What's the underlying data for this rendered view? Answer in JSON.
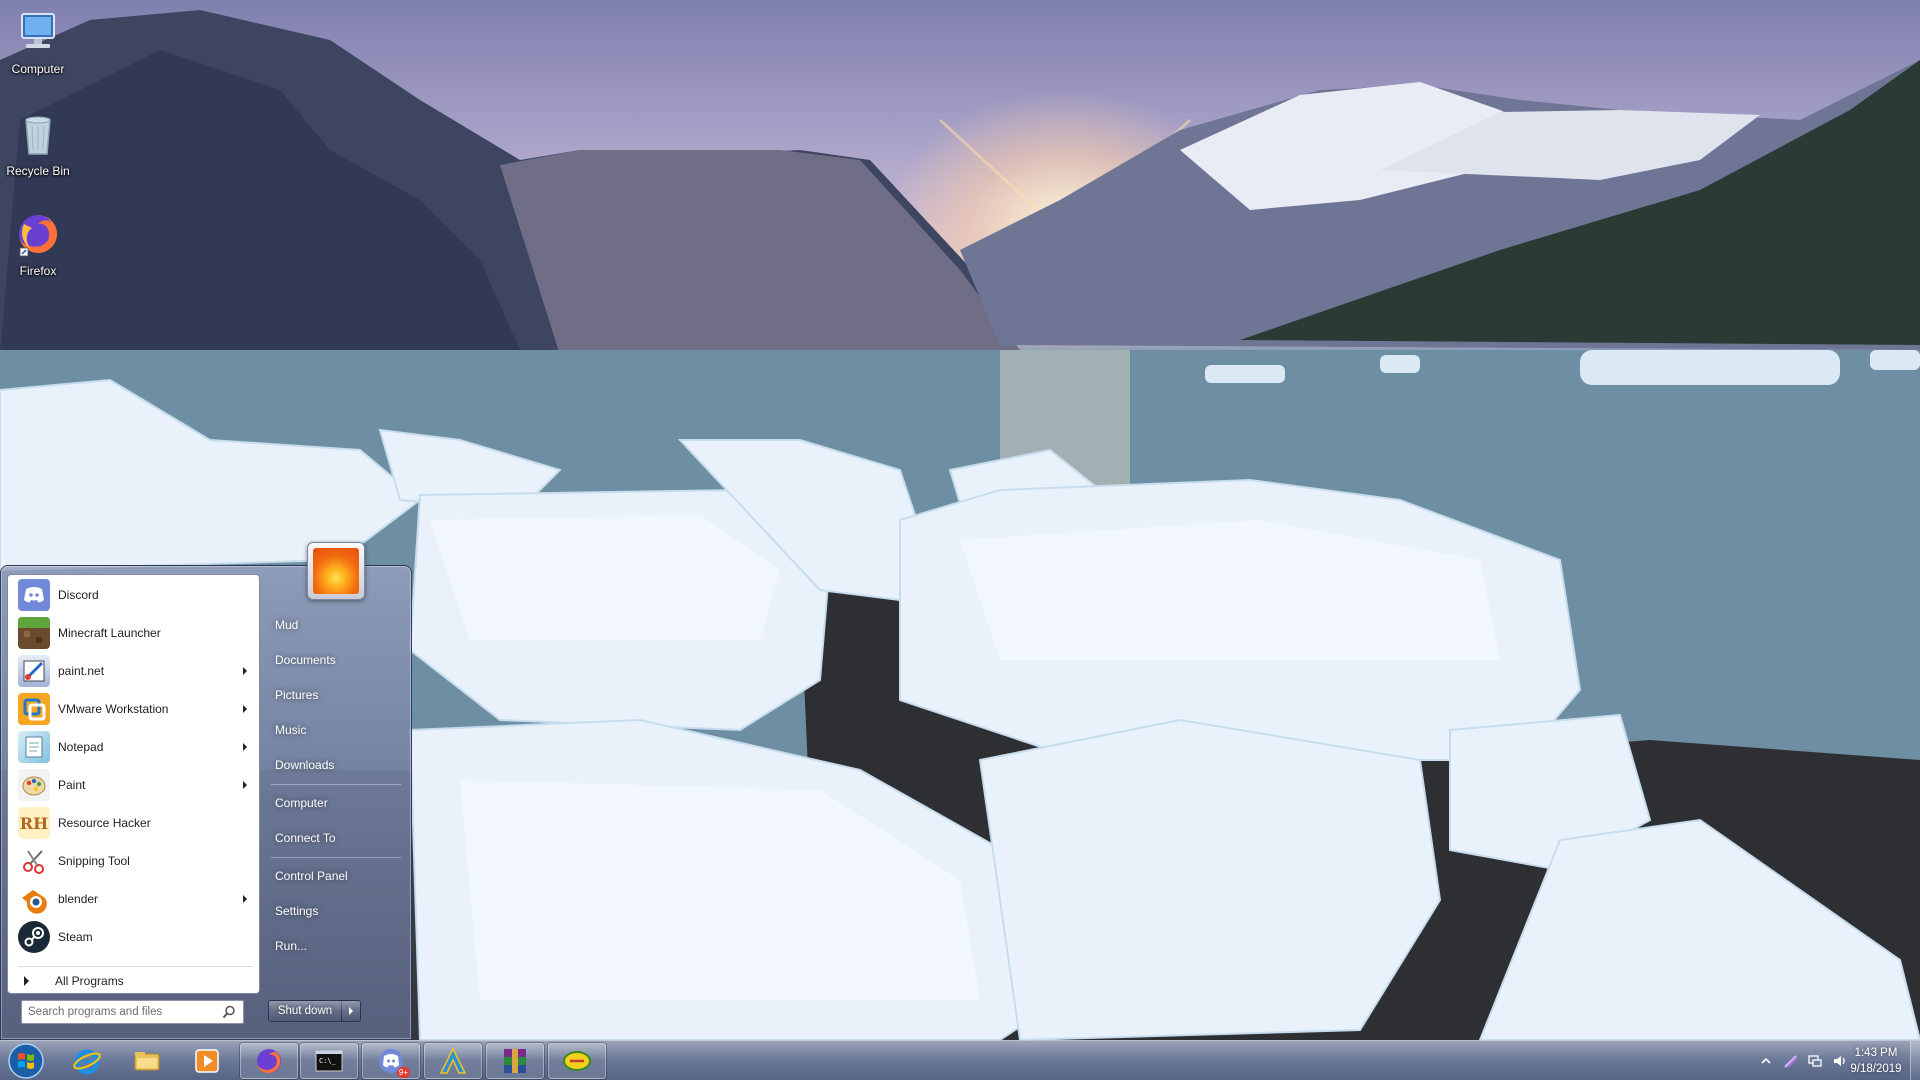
{
  "desktop": {
    "icons": [
      {
        "label": "Computer",
        "icon": "computer-icon"
      },
      {
        "label": "Recycle Bin",
        "icon": "recycle-bin-icon"
      },
      {
        "label": "Firefox",
        "icon": "firefox-icon"
      }
    ]
  },
  "start_menu": {
    "programs": [
      {
        "label": "Discord",
        "icon": "discord-icon",
        "has_submenu": false
      },
      {
        "label": "Minecraft Launcher",
        "icon": "minecraft-icon",
        "has_submenu": false
      },
      {
        "label": "paint.net",
        "icon": "paint-net-icon",
        "has_submenu": true
      },
      {
        "label": "VMware Workstation",
        "icon": "vmware-icon",
        "has_submenu": true
      },
      {
        "label": "Notepad",
        "icon": "notepad-icon",
        "has_submenu": true
      },
      {
        "label": "Paint",
        "icon": "paint-icon",
        "has_submenu": true
      },
      {
        "label": "Resource Hacker",
        "icon": "resource-hacker-icon",
        "has_submenu": false
      },
      {
        "label": "Snipping Tool",
        "icon": "snipping-tool-icon",
        "has_submenu": false
      },
      {
        "label": "blender",
        "icon": "blender-icon",
        "has_submenu": true
      },
      {
        "label": "Steam",
        "icon": "steam-icon",
        "has_submenu": false
      }
    ],
    "all_programs_label": "All Programs",
    "search_placeholder": "Search programs and files",
    "right_items": {
      "user": "Mud",
      "documents": "Documents",
      "pictures": "Pictures",
      "music": "Music",
      "downloads": "Downloads",
      "computer": "Computer",
      "connect_to": "Connect To",
      "control_panel": "Control Panel",
      "settings": "Settings",
      "run": "Run..."
    },
    "shutdown_label": "Shut down"
  },
  "taskbar": {
    "pinned": [
      {
        "icon": "internet-explorer-icon"
      },
      {
        "icon": "file-explorer-icon"
      },
      {
        "icon": "media-player-icon"
      },
      {
        "icon": "firefox-icon"
      },
      {
        "icon": "command-prompt-icon"
      },
      {
        "icon": "discord-icon",
        "badge": "9+"
      },
      {
        "icon": "arc-launcher-icon"
      },
      {
        "icon": "winrar-icon"
      },
      {
        "icon": "yellow-app-icon"
      }
    ],
    "clock": {
      "time": "1:43 PM",
      "date": "9/18/2019"
    }
  },
  "colors": {
    "accent": "#2a66c8",
    "discord": "#7289da",
    "firefox": "#ff7139"
  }
}
